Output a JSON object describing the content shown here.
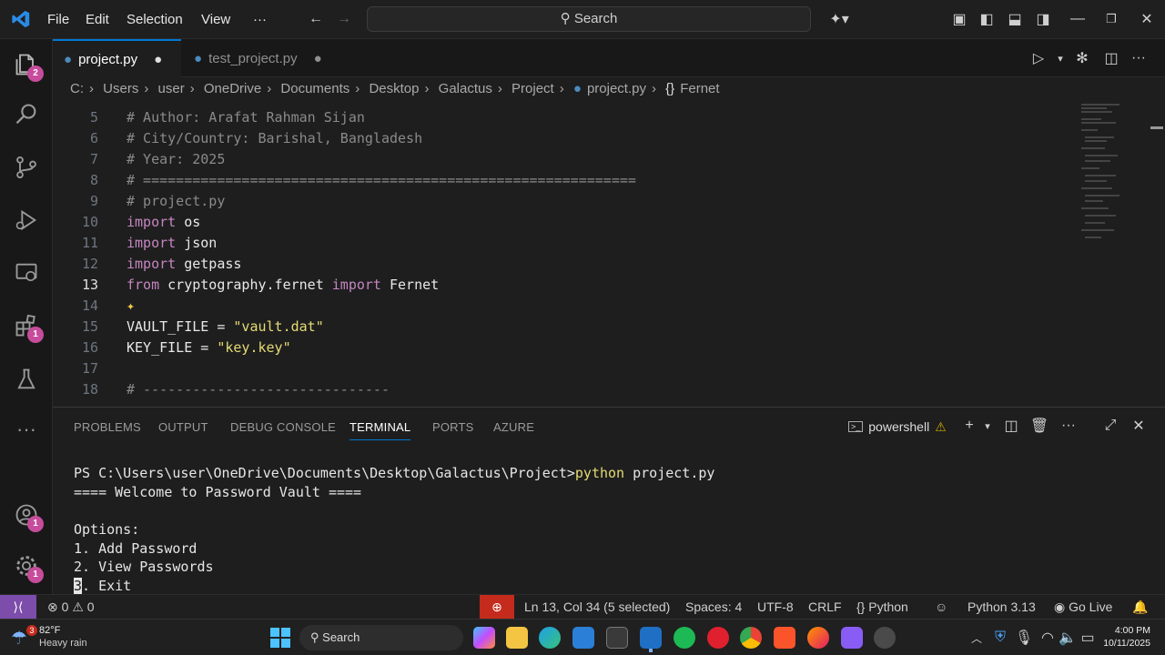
{
  "titlebar": {
    "menus": [
      "File",
      "Edit",
      "Selection",
      "View",
      "···"
    ],
    "search_label": "Search"
  },
  "activity": {
    "explorer_badge": "2",
    "extensions_badge": "1",
    "accounts_badge": "1",
    "settings_badge": "1"
  },
  "tabs": [
    {
      "label": "project.py",
      "active": true,
      "modified": true
    },
    {
      "label": "test_project.py",
      "active": false,
      "modified": true
    }
  ],
  "breadcrumb": [
    "C:",
    "Users",
    "user",
    "OneDrive",
    "Documents",
    "Desktop",
    "Galactus",
    "Project",
    "project.py",
    "Fernet"
  ],
  "editor": {
    "lines": [
      {
        "n": "5",
        "text": "# Author: Arafat Rahman Sijan"
      },
      {
        "n": "6",
        "text": "# City/Country: Barishal, Bangladesh"
      },
      {
        "n": "7",
        "text": "# Year: 2025"
      },
      {
        "n": "8",
        "text": "# ============================================================"
      },
      {
        "n": "9",
        "text": "# project.py"
      },
      {
        "n": "10",
        "kw": "import",
        "rest": " os"
      },
      {
        "n": "11",
        "kw": "import",
        "rest": " json"
      },
      {
        "n": "12",
        "kw": "import",
        "rest": " getpass"
      },
      {
        "n": "13",
        "kw": "from",
        "mod": " cryptography.fernet ",
        "kw2": "import",
        "rest": " Fernet"
      },
      {
        "n": "14",
        "text": ""
      },
      {
        "n": "15",
        "id": "VAULT_FILE = ",
        "str": "\"vault.dat\""
      },
      {
        "n": "16",
        "id": "KEY_FILE = ",
        "str": "\"key.key\""
      },
      {
        "n": "17",
        "text": ""
      },
      {
        "n": "18",
        "text": "# ------------------------------"
      }
    ]
  },
  "panel": {
    "tabs": [
      "PROBLEMS",
      "OUTPUT",
      "DEBUG CONSOLE",
      "TERMINAL",
      "PORTS",
      "AZURE"
    ],
    "active_tab": "TERMINAL",
    "terminal_name": "powershell",
    "terminal": {
      "prompt": "PS C:\\Users\\user\\OneDrive\\Documents\\Desktop\\Galactus\\Project>",
      "command": "python",
      "arg": " project.py",
      "lines": [
        "==== Welcome to Password Vault ====",
        "",
        "Options:",
        "1. Add Password",
        "2. View Passwords"
      ],
      "cursor_char": "3",
      "last_line_rest": ". Exit"
    }
  },
  "statusbar": {
    "errors": "0",
    "warnings": "0",
    "position": "Ln 13, Col 34 (5 selected)",
    "spaces": "Spaces: 4",
    "encoding": "UTF-8",
    "eol": "CRLF",
    "language": "Python",
    "interpreter": "Python 3.13",
    "golive": "Go Live"
  },
  "taskbar": {
    "weather_temp": "82°F",
    "weather_desc": "Heavy rain",
    "weather_badge": "3",
    "search_label": "Search",
    "time": "4:00 PM",
    "date": "10/11/2025"
  },
  "colors": {
    "accent": "#0078d4",
    "badge": "#c74c9c",
    "warning": "#cca700",
    "debug_red": "#c42b1c"
  }
}
